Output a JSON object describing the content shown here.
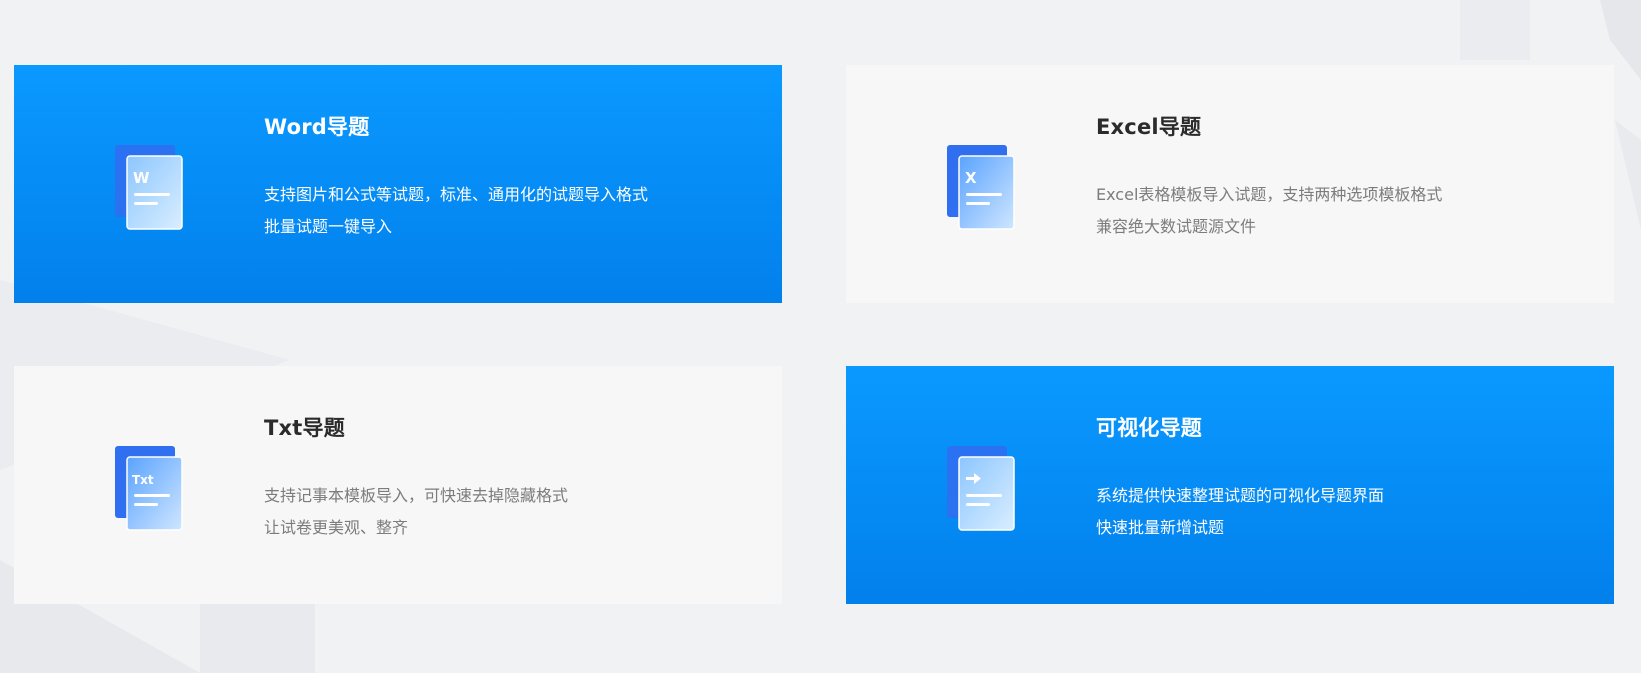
{
  "cards": [
    {
      "title": "Word导题",
      "desc_line1": "支持图片和公式等试题，标准、通用化的试题导入格式",
      "desc_line2": "批量试题一键导入",
      "icon_label": "W",
      "icon": "word-doc-icon",
      "active": true
    },
    {
      "title": "Excel导题",
      "desc_line1": "Excel表格模板导入试题，支持两种选项模板格式",
      "desc_line2": "兼容绝大数试题源文件",
      "icon_label": "X",
      "icon": "excel-doc-icon",
      "active": false
    },
    {
      "title": "Txt导题",
      "desc_line1": "支持记事本模板导入，可快速去掉隐藏格式",
      "desc_line2": "让试卷更美观、整齐",
      "icon_label": "Txt",
      "icon": "txt-doc-icon",
      "active": false
    },
    {
      "title": "可视化导题",
      "desc_line1": "系统提供快速整理试题的可视化导题界面",
      "desc_line2": "快速批量新增试题",
      "icon_label": "",
      "icon": "visual-doc-icon",
      "active": true
    }
  ],
  "colors": {
    "page_background": "#f1f2f4",
    "active_card_top": "#0a99ff",
    "active_card_bottom": "#0280ec",
    "inactive_card": "#f7f7f7",
    "title_dark": "#2b2b2b",
    "desc_gray": "#7c7c7c",
    "icon_blue": "#2e7bf0"
  }
}
